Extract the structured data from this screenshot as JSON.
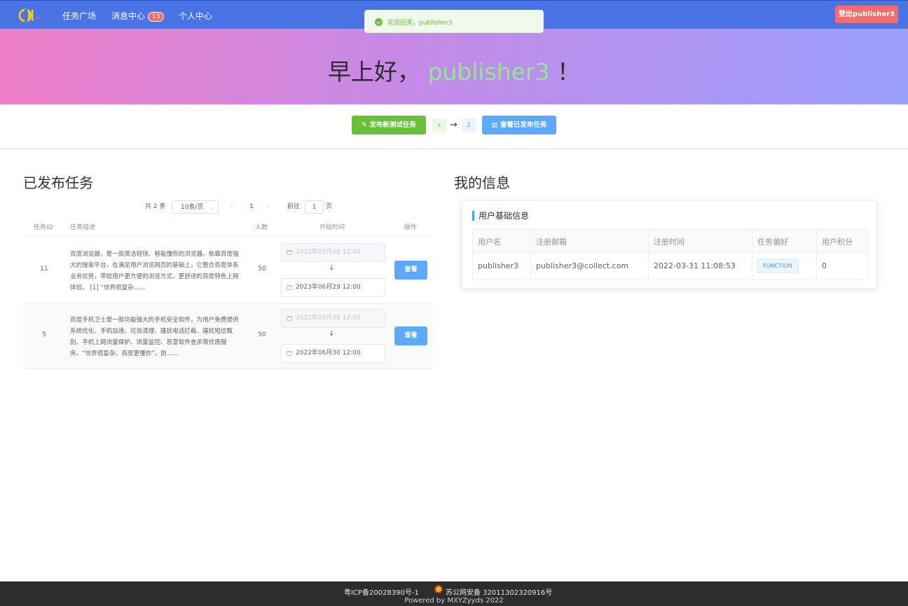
{
  "nav": {
    "logo_icon": "cll-logo",
    "items": [
      {
        "label": "任务广场"
      },
      {
        "label": "消息中心",
        "badge": "13"
      },
      {
        "label": "个人中心"
      }
    ],
    "logout_label": "登出publisher3"
  },
  "toast": {
    "text": "欢迎回来，publisher3",
    "icon": "success-check-icon"
  },
  "hero": {
    "greeting_prefix": "早上好，",
    "username": "publisher3",
    "greeting_suffix": "！"
  },
  "actions": {
    "publish_label": "发布新测试任务",
    "plus_label": "+",
    "arrow": "→",
    "count": "2",
    "view_label": "查看已发布任务"
  },
  "tasks": {
    "title": "已发布任务",
    "pagination": {
      "total": "共 2 条",
      "page_size": "10条/页",
      "prev": "‹",
      "current": "1",
      "next": "›",
      "goto_label": "前往",
      "goto_value": "1",
      "page_label": "页"
    },
    "columns": [
      "任务ID",
      "任务描述",
      "人数",
      "开始时间",
      "操作"
    ],
    "rows": [
      {
        "id": "11",
        "desc": "百度浏览器，是一款简洁轻快、智能懂你的浏览器。依靠百度强大的搜索平台，在满足用户浏览网页的基础上，它整合百度体系业务优势，带给用户更方便的浏览方式，更舒适的百度特色上网体验。 [1] “世界很复杂......",
        "people": "50",
        "start": "2022年05月28 12:00",
        "arrow": "↓",
        "end": "2023年06月29 12:00",
        "action": "查看"
      },
      {
        "id": "5",
        "desc": "百度手机卫士是一款功能强大的手机安全软件，为用户免费提供系统优化、手机加速、垃圾清理、骚扰电话拦截、骚扰短信甄别、手机上网流量保护、流量监控、恶意软件查杀等优质服务。“世界很复杂，百度更懂你”，防......",
        "people": "50",
        "start": "2022年05月28 12:00",
        "arrow": "↓",
        "end": "2022年06月30 12:00",
        "action": "查看"
      }
    ]
  },
  "my_info": {
    "title": "我的信息",
    "card_title": "用户基础信息",
    "columns": [
      "用户名",
      "注册邮箱",
      "注册时间",
      "任务偏好",
      "用户积分"
    ],
    "row": {
      "username": "publisher3",
      "email": "publisher3@collect.com",
      "registered": "2022-03-31 11:08:53",
      "preference": "FUNCTION",
      "points": "0"
    }
  },
  "footer": {
    "icp": "粤ICP备20028390号-1",
    "gongan": "苏公网安备 32011302320916号",
    "powered": "Powered by MXYZyyds 2022"
  },
  "colors": {
    "nav_bg": "#4a73e6",
    "success": "#67c23a",
    "primary": "#409eff",
    "danger": "#f56c6c",
    "username_green": "#95e49a"
  }
}
